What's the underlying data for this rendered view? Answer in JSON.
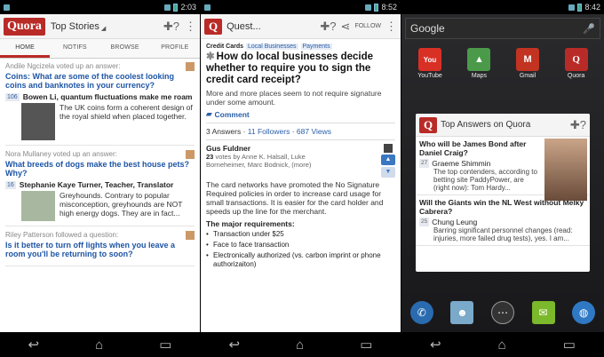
{
  "screen1": {
    "status": {
      "time": "2:03"
    },
    "appbar": {
      "logo": "Quora",
      "dropdown": "Top Stories"
    },
    "tabs": [
      "HOME",
      "NOTIFS",
      "BROWSE",
      "PROFILE"
    ],
    "feed": [
      {
        "voter": "Andile Ngcizela voted up an answer:",
        "question": "Coins: What are some of the coolest looking coins and banknotes in your currency?",
        "count": "106",
        "author": "Bowen Li, quantum fluctuations make me roam",
        "text": "The UK coins form a coherent design of the royal shield when placed together."
      },
      {
        "voter": "Nora Mullaney voted up an answer:",
        "question": "What breeds of dogs make the best house pets? Why?",
        "count": "16",
        "author": "Stephanie Kaye Turner, Teacher, Translator",
        "text": "Greyhounds. Contrary to popular misconception, greyhounds are NOT high energy dogs. They are in fact..."
      },
      {
        "voter": "Riley Patterson followed a question:",
        "question": "Is it better to turn off lights when you leave a room you'll be returning to soon?",
        "count": "",
        "author": "",
        "text": ""
      }
    ]
  },
  "screen2": {
    "status": {
      "time": "8:52"
    },
    "appbar": {
      "title": "Quest...",
      "follow": "FOLLOW"
    },
    "topics": {
      "lead": "Credit Cards",
      "tags": [
        "Local Businesses",
        "Payments"
      ]
    },
    "question": "How do local businesses decide whether to require you to sign the credit card receipt?",
    "details": "More and more places seem to not require signature under some amount.",
    "comment": "Comment",
    "stats": {
      "answers": "3 Answers",
      "followers": "11 Followers",
      "views": "687 Views"
    },
    "answer": {
      "author": "Gus Fuldner",
      "votes_count": "23",
      "votes_text": "votes by Anne K. Halsall, Luke Borneheimer, Marc Bodnick, (more)",
      "body": "The card networks have promoted the No Signature Required policies in order to increase card usage for small transactions. It is easier for the card holder and speeds up the line for the merchant.",
      "req_title": "The major requirements:",
      "requirements": [
        "Transaction under $25",
        "Face to face transaction",
        "Electronically authorized (vs. carbon imprint or phone authorizaiton)"
      ]
    }
  },
  "screen3": {
    "status": {
      "time": "8:42"
    },
    "search": "Google",
    "apps": [
      {
        "label": "YouTube",
        "glyph": "You",
        "color": "#d93025"
      },
      {
        "label": "Maps",
        "glyph": "▲",
        "color": "#4a9a4a"
      },
      {
        "label": "Gmail",
        "glyph": "M",
        "color": "#c23321"
      },
      {
        "label": "Quora",
        "glyph": "Q",
        "color": "#b92b27"
      }
    ],
    "widget": {
      "title": "Top Answers on Quora",
      "items": [
        {
          "question": "Who will be James Bond after Daniel Craig?",
          "count": "27",
          "author": "Graeme Shimmin",
          "text": "The top contenders, according to betting site PaddyPower, are (right now): Tom Hardy..."
        },
        {
          "question": "Will the Giants win the NL West without Melky Cabrera?",
          "count": "25",
          "author": "Chung Leung",
          "text": "Barring significant personnel changes (read: injuries, more failed drug tests), yes. I am..."
        }
      ]
    }
  }
}
